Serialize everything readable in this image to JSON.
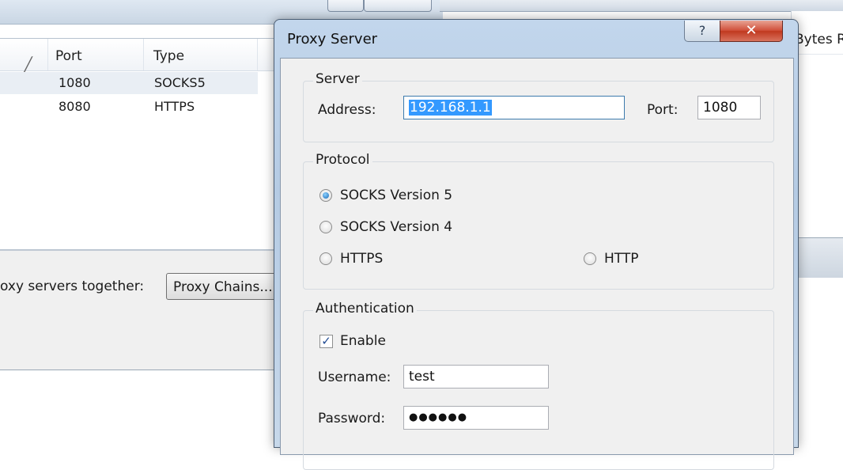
{
  "background_window": {
    "list": {
      "columns": {
        "sort_glyph": "╱",
        "port": "Port",
        "type": "Type"
      },
      "rows": [
        {
          "port": "1080",
          "type": "SOCKS5"
        },
        {
          "port": "8080",
          "type": "HTTPS"
        }
      ]
    },
    "chain_label": "oxy servers together:",
    "chain_button": "Proxy Chains...",
    "right_header": "Bytes R"
  },
  "dialog": {
    "title": "Proxy Server",
    "help_label": "?",
    "close_label": "✕",
    "server": {
      "group_label": "Server",
      "address_label": "Address:",
      "address_value": "192.168.1.1",
      "port_label": "Port:",
      "port_value": "1080"
    },
    "protocol": {
      "group_label": "Protocol",
      "options": [
        "SOCKS Version 5",
        "SOCKS Version 4",
        "HTTPS",
        "HTTP"
      ],
      "selected": "SOCKS Version 5"
    },
    "authentication": {
      "group_label": "Authentication",
      "enable_label": "Enable",
      "enable_checked": true,
      "check_glyph": "✓",
      "username_label": "Username:",
      "username_value": "test",
      "password_label": "Password:",
      "password_value": "●●●●●●"
    }
  },
  "colors": {
    "selection": "#3399ff",
    "dialog_frame": "#b5cbe4",
    "close_button": "#c0391f"
  }
}
